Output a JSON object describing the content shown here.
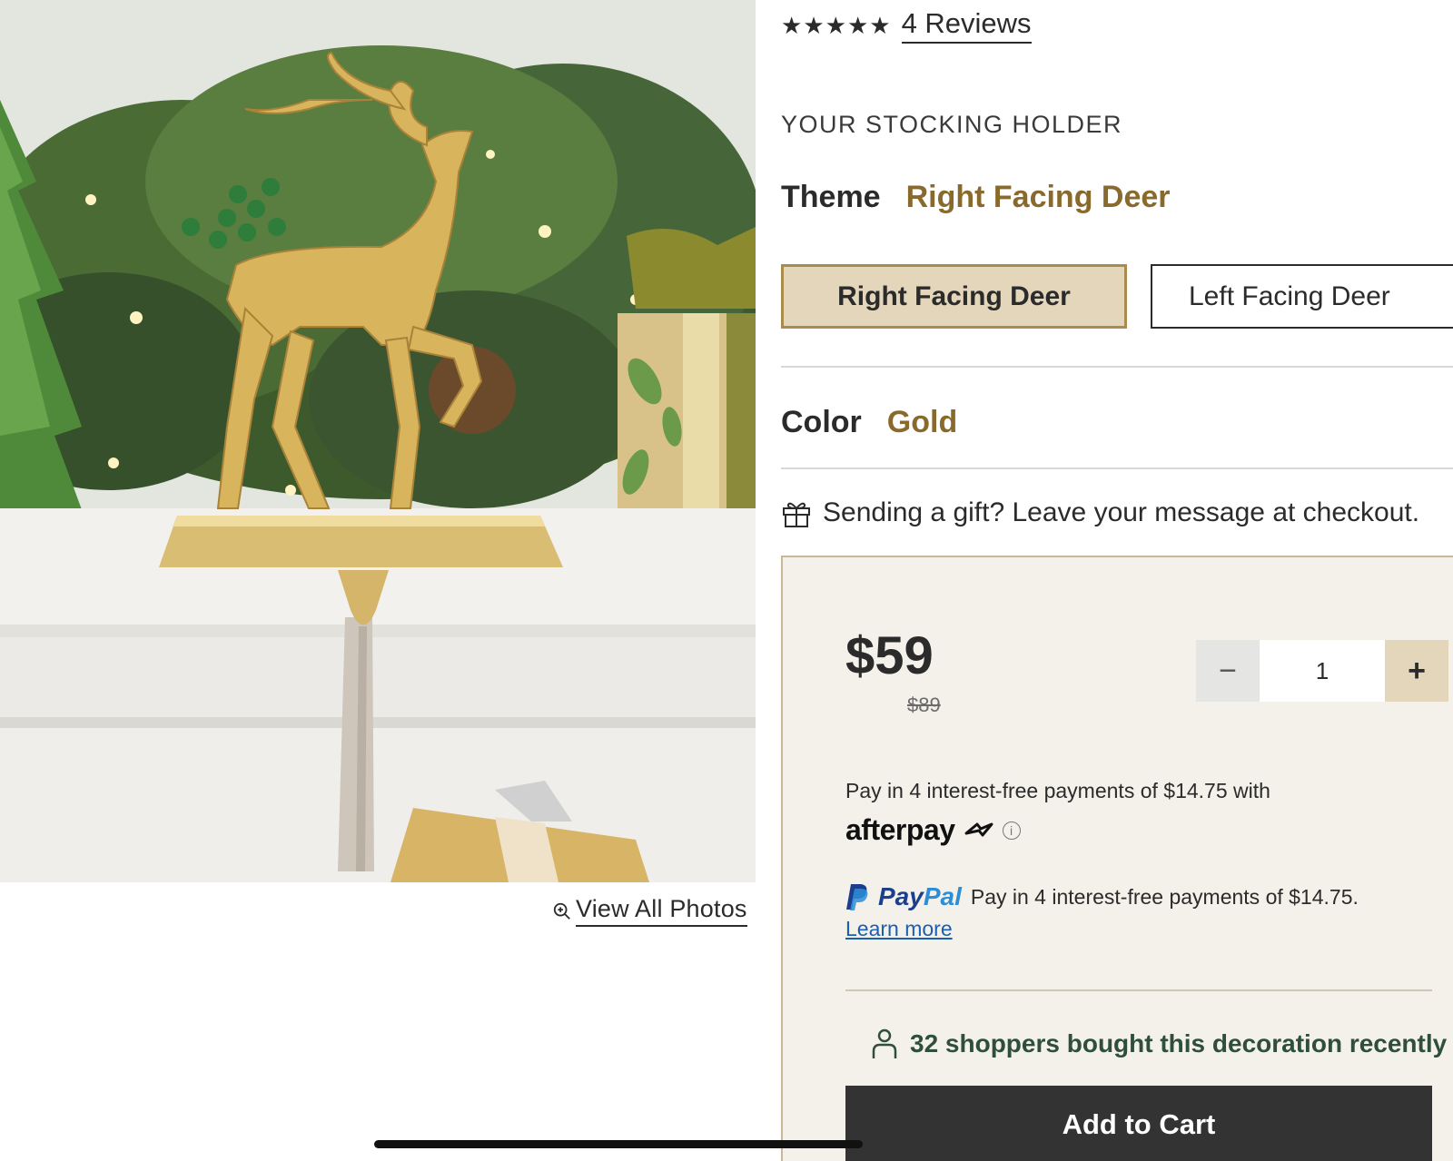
{
  "product": {
    "rating_stars": 5,
    "reviews_label": "4 Reviews",
    "section_title": "YOUR STOCKING HOLDER",
    "theme_label": "Theme",
    "theme_value": "Right Facing Deer",
    "theme_options": [
      "Right Facing Deer",
      "Left Facing Deer"
    ],
    "theme_selected_index": 0,
    "color_label": "Color",
    "color_value": "Gold",
    "gift_message": "Sending a gift? Leave your message at checkout."
  },
  "gallery": {
    "view_all_label": "View All Photos"
  },
  "purchase": {
    "price": "$59",
    "old_price": "$89",
    "quantity": "1",
    "minus_symbol": "−",
    "plus_symbol": "+",
    "afterpay_text": "Pay in 4 interest-free payments of $14.75 with",
    "afterpay_brand": "afterpay",
    "afterpay_info_symbol": "i",
    "paypal_brand_pay": "Pay",
    "paypal_brand_pal": "Pal",
    "paypal_text": "Pay in 4 interest-free payments of $14.75.",
    "learn_more": "Learn more",
    "shoppers_text": "32 shoppers bought this decoration recently",
    "add_to_cart": "Add to Cart"
  },
  "colors": {
    "accent_gold": "#8a6a2c",
    "selected_bg": "#e3d6bb",
    "panel_bg": "#f4f1ea",
    "button_dark": "#333333",
    "shoppers_green": "#2f4f3a",
    "paypal_blue": "#1b3e8f"
  },
  "icons": {
    "star": "star-icon",
    "zoom": "zoom-in-icon",
    "gift": "gift-icon",
    "person": "person-icon",
    "info": "info-icon"
  }
}
